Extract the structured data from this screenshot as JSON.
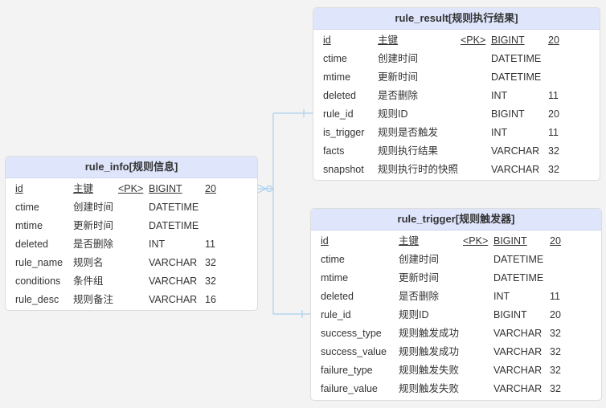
{
  "tables": {
    "rule_info": {
      "title": "rule_info[规则信息]",
      "rows": [
        {
          "name": "id",
          "comment": "主键",
          "key": "<PK>",
          "type": "BIGINT",
          "len": "20"
        },
        {
          "name": "ctime",
          "comment": "创建时间",
          "key": "",
          "type": "DATETIME",
          "len": ""
        },
        {
          "name": "mtime",
          "comment": "更新时间",
          "key": "",
          "type": "DATETIME",
          "len": ""
        },
        {
          "name": "deleted",
          "comment": "是否删除",
          "key": "",
          "type": "INT",
          "len": "11"
        },
        {
          "name": "rule_name",
          "comment": "规则名",
          "key": "",
          "type": "VARCHAR",
          "len": "32"
        },
        {
          "name": "conditions",
          "comment": "条件组",
          "key": "",
          "type": "VARCHAR",
          "len": "32"
        },
        {
          "name": "rule_desc",
          "comment": "规则备注",
          "key": "",
          "type": "VARCHAR",
          "len": "16"
        }
      ]
    },
    "rule_result": {
      "title": "rule_result[规则执行结果]",
      "rows": [
        {
          "name": "id",
          "comment": "主键",
          "key": "<PK>",
          "type": "BIGINT",
          "len": "20"
        },
        {
          "name": "ctime",
          "comment": "创建时间",
          "key": "",
          "type": "DATETIME",
          "len": ""
        },
        {
          "name": "mtime",
          "comment": "更新时间",
          "key": "",
          "type": "DATETIME",
          "len": ""
        },
        {
          "name": "deleted",
          "comment": "是否删除",
          "key": "",
          "type": "INT",
          "len": "11"
        },
        {
          "name": "rule_id",
          "comment": "规则ID",
          "key": "",
          "type": "BIGINT",
          "len": "20"
        },
        {
          "name": "is_trigger",
          "comment": "规则是否触发",
          "key": "",
          "type": "INT",
          "len": "11"
        },
        {
          "name": "facts",
          "comment": "规则执行结果",
          "key": "",
          "type": "VARCHAR",
          "len": "32"
        },
        {
          "name": "snapshot",
          "comment": "规则执行时的快照",
          "key": "",
          "type": "VARCHAR",
          "len": "32"
        }
      ]
    },
    "rule_trigger": {
      "title": "rule_trigger[规则触发器]",
      "rows": [
        {
          "name": "id",
          "comment": "主键",
          "key": "<PK>",
          "type": "BIGINT",
          "len": "20"
        },
        {
          "name": "ctime",
          "comment": "创建时间",
          "key": "",
          "type": "DATETIME",
          "len": ""
        },
        {
          "name": "mtime",
          "comment": "更新时间",
          "key": "",
          "type": "DATETIME",
          "len": ""
        },
        {
          "name": "deleted",
          "comment": "是否删除",
          "key": "",
          "type": "INT",
          "len": "11"
        },
        {
          "name": "rule_id",
          "comment": "规则ID",
          "key": "",
          "type": "BIGINT",
          "len": "20"
        },
        {
          "name": "success_type",
          "comment": "规则触发成功",
          "key": "",
          "type": "VARCHAR",
          "len": "32"
        },
        {
          "name": "success_value",
          "comment": "规则触发成功",
          "key": "",
          "type": "VARCHAR",
          "len": "32"
        },
        {
          "name": "failure_type",
          "comment": "规则触发失败",
          "key": "",
          "type": "VARCHAR",
          "len": "32"
        },
        {
          "name": "failure_value",
          "comment": "规则触发失败",
          "key": "",
          "type": "VARCHAR",
          "len": "32"
        }
      ]
    }
  },
  "relations": [
    {
      "from": "rule_info.id",
      "to": "rule_result.rule_id",
      "cardinality": "one-to-many"
    },
    {
      "from": "rule_info.id",
      "to": "rule_trigger.rule_id",
      "cardinality": "one-to-many"
    }
  ],
  "colors": {
    "canvas": "#f3f3f3",
    "header": "#dfe6fc",
    "edge": "#a9d0ee",
    "text": "#333333"
  }
}
